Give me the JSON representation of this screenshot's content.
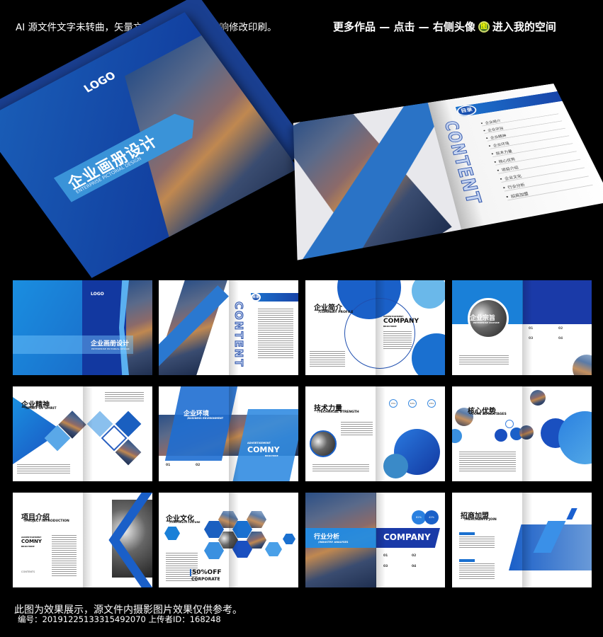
{
  "header": {
    "notice": "AI 源文件文字未转曲，矢量文件放大缩小，不影响修改印刷。",
    "promo_before": "更多作品 — 点击 — 右侧头像",
    "promo_badge": "图",
    "promo_after": "进入我的空间"
  },
  "hero_cover": {
    "logo": "LOGO",
    "title": "企业画册设计",
    "subtitle": "ENTERPRISE PICTORIAL DESIGN"
  },
  "open_book": {
    "badge": "目录",
    "vertical_title": "CONTENT",
    "toc": [
      "企业简介",
      "企业宗旨",
      "企业精神",
      "企业环境",
      "技术力量",
      "核心优势",
      "项目介绍",
      "企业文化",
      "行业分析",
      "招商加盟"
    ]
  },
  "spreads": [
    {
      "title": "企业画册设计",
      "subtitle": "ENTERPRISE PICTORIAL DESIGN",
      "logo": "LOGO"
    },
    {
      "title": "CONTENT",
      "badge": "目录"
    },
    {
      "title": "企业简介",
      "subtitle": "/COMPANY PROFILE",
      "kicker": "ADVERTISEMENT",
      "headline": "COMPANY",
      "tag": "BROCHURE"
    },
    {
      "title": "企业宗旨",
      "subtitle": "ENTERPRISE CULTURE",
      "nums": [
        "01",
        "02",
        "03",
        "04"
      ]
    },
    {
      "title": "企业精神",
      "subtitle": "/SPIRIT OF SPIRIT"
    },
    {
      "title": "企业环境",
      "subtitle": "/BUSINESS ENVIRONMENT",
      "kicker": "ADVERTISEMENT",
      "headline": "COMNY",
      "tag": "BROCHURE",
      "nums": [
        "01",
        "02"
      ]
    },
    {
      "title": "技术力量",
      "subtitle": "/TECHNICAL STRENGTH",
      "stats": [
        "75%",
        "50%",
        "25%"
      ]
    },
    {
      "title": "核心优势",
      "subtitle": "/CORE ADVANTAGES"
    },
    {
      "title": "项目介绍",
      "subtitle": "/PROJECT INTRODUCTION",
      "kicker": "ADVERTISEMENT",
      "headline": "COMNY",
      "tag": "BROCHURE",
      "contents": "CONTENTS"
    },
    {
      "title": "企业文化",
      "subtitle": "/CORPORATE CULTURE",
      "promo": "50%OFF",
      "promo_sub": "CORPORATE"
    },
    {
      "title": "行业分析",
      "subtitle": "/INDUSTRY ANALYSES",
      "headline": "COMPANY",
      "stats": [
        "82%",
        "42%"
      ],
      "nums": [
        "01",
        "02",
        "03",
        "04"
      ]
    },
    {
      "title": "招商加盟",
      "subtitle": "/MERCHANTS JOIN"
    }
  ],
  "footer": {
    "disclaimer": "此图为效果展示，源文件内摄影图片效果仅供参考。",
    "id_line": "编号：20191225133315492070 上传者ID：168248"
  },
  "colors": {
    "background": "#000000",
    "brand_blue": "#1a5fc0",
    "light_blue": "#3a93d8",
    "dark_blue": "#0d2f7c"
  }
}
